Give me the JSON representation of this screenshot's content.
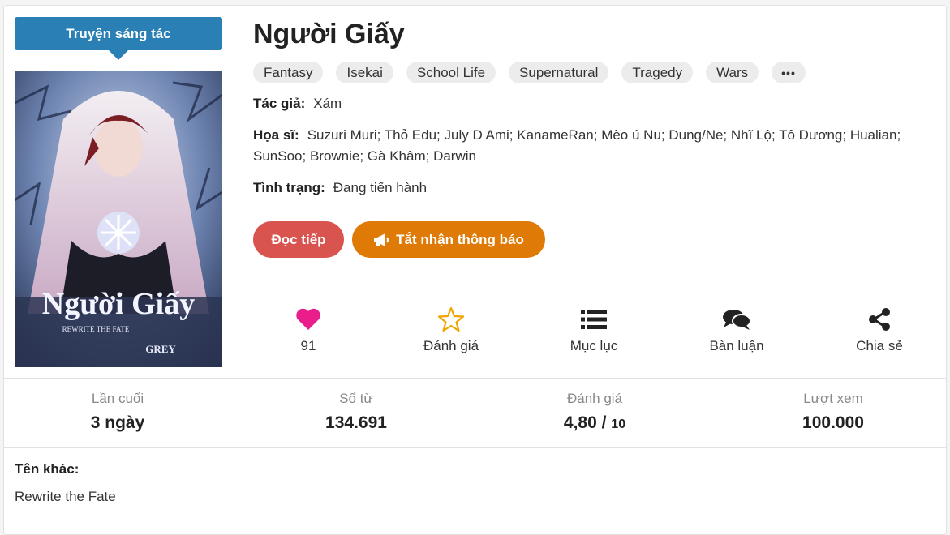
{
  "badge": "Truyện sáng tác",
  "title": "Người Giấy",
  "tags": [
    "Fantasy",
    "Isekai",
    "School Life",
    "Supernatural",
    "Tragedy",
    "Wars"
  ],
  "more_tags": "•••",
  "author": {
    "label": "Tác giả:",
    "value": "Xám"
  },
  "artist": {
    "label": "Họa sĩ:",
    "value": "Suzuri Muri; Thỏ Edu; July D Ami; KanameRan; Mèo ú Nu; Dung/Ne; Nhĩ Lộ; Tô Dương; Hualian; SunSoo; Brownie; Gà Khâm; Darwin"
  },
  "status": {
    "label": "Tình trạng:",
    "value": "Đang tiến hành"
  },
  "buttons": {
    "read": "Đọc tiếp",
    "notify": "Tắt nhận thông báo"
  },
  "actions": {
    "likes": "91",
    "rate": "Đánh giá",
    "toc": "Mục lục",
    "discuss": "Bàn luận",
    "share": "Chia sẻ"
  },
  "stats": {
    "last": {
      "label": "Lần cuối",
      "value": "3 ngày"
    },
    "words": {
      "label": "Số từ",
      "value": "134.691"
    },
    "rating": {
      "label": "Đánh giá",
      "value": "4,80 /",
      "max": "10"
    },
    "views": {
      "label": "Lượt xem",
      "value": "100.000"
    }
  },
  "other_names": {
    "label": "Tên khác:",
    "value": "Rewrite the Fate"
  },
  "cover": {
    "title_art": "Người Giấy",
    "subtitle_art": "REWRITE THE FATE",
    "author_art": "GREY"
  },
  "colors": {
    "badge": "#2a7fb4",
    "read": "#d9534f",
    "notify": "#e07a06",
    "heart": "#e91e8c",
    "star": "#f0a500"
  }
}
